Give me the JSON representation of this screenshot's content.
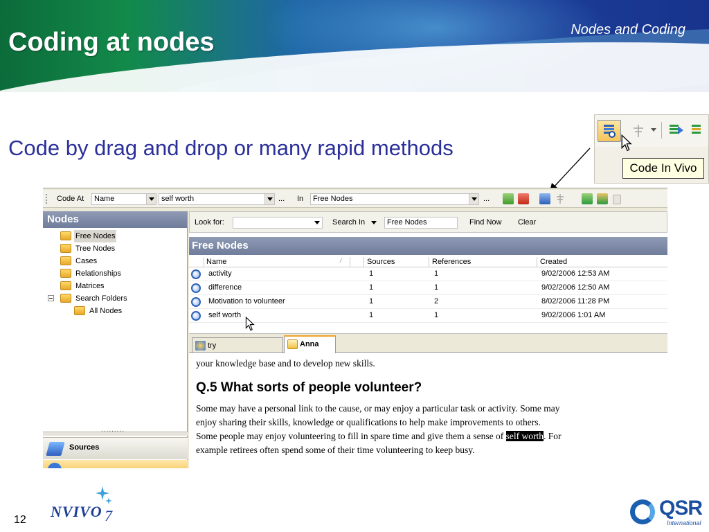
{
  "slide": {
    "title": "Coding at nodes",
    "section": "Nodes and Coding",
    "subtitle": "Code by drag and drop or many rapid methods",
    "page_number": "12"
  },
  "callout": {
    "tooltip": "Code In Vivo"
  },
  "code_bar": {
    "code_at_label": "Code At",
    "code_at_value": "Name",
    "node_value": "self worth",
    "ellipsis": "...",
    "in_label": "In",
    "in_value": "Free Nodes",
    "ellipsis2": "..."
  },
  "nav": {
    "header": "Nodes",
    "items": [
      {
        "label": "Free Nodes",
        "selected": true
      },
      {
        "label": "Tree Nodes"
      },
      {
        "label": "Cases"
      },
      {
        "label": "Relationships"
      },
      {
        "label": "Matrices"
      },
      {
        "label": "Search Folders"
      },
      {
        "label": "All Nodes"
      }
    ],
    "sources_button": "Sources"
  },
  "find_bar": {
    "look_for_label": "Look for:",
    "look_for_value": "",
    "search_in_label": "Search In",
    "search_in_value": "Free Nodes",
    "find_now": "Find Now",
    "clear": "Clear"
  },
  "free_nodes": {
    "header": "Free Nodes",
    "columns": [
      "Name",
      "Sources",
      "References",
      "Created"
    ],
    "rows": [
      {
        "name": "activity",
        "sources": "1",
        "references": "1",
        "created": "9/02/2006 12:53 AM"
      },
      {
        "name": "difference",
        "sources": "1",
        "references": "1",
        "created": "9/02/2006 12:50 AM"
      },
      {
        "name": "Motivation to volunteer",
        "sources": "1",
        "references": "2",
        "created": "8/02/2006 11:28 PM"
      },
      {
        "name": "self worth",
        "sources": "1",
        "references": "1",
        "created": "9/02/2006 1:01 AM"
      }
    ]
  },
  "tabs": [
    {
      "label": "try"
    },
    {
      "label": "Anna",
      "active": true
    }
  ],
  "document": {
    "line0": "your knowledge base and to develop new skills.",
    "heading": "Q.5 What sorts of people volunteer?",
    "line1": "Some may have a personal link to the cause, or may enjoy a particular task or activity. Some may",
    "line2": "enjoy sharing their skills, knowledge or qualifications to help make improvements to others.",
    "line3_before": "Some people may enjoy volunteering to fill in spare time and give them a sense of ",
    "line3_highlight": "self worth",
    "line3_after": ". For",
    "line4": "example retirees often spend some of their time volunteering to keep busy."
  },
  "logos": {
    "nvivo": "NVIVO",
    "nvivo_version": "7",
    "qsr": "QSR",
    "qsr_sub": "International"
  },
  "colors": {
    "title_text": "#ffffff",
    "subtitle_text": "#2a2f9a",
    "panel_header": "#7b87a5",
    "highlight": "#000000"
  }
}
